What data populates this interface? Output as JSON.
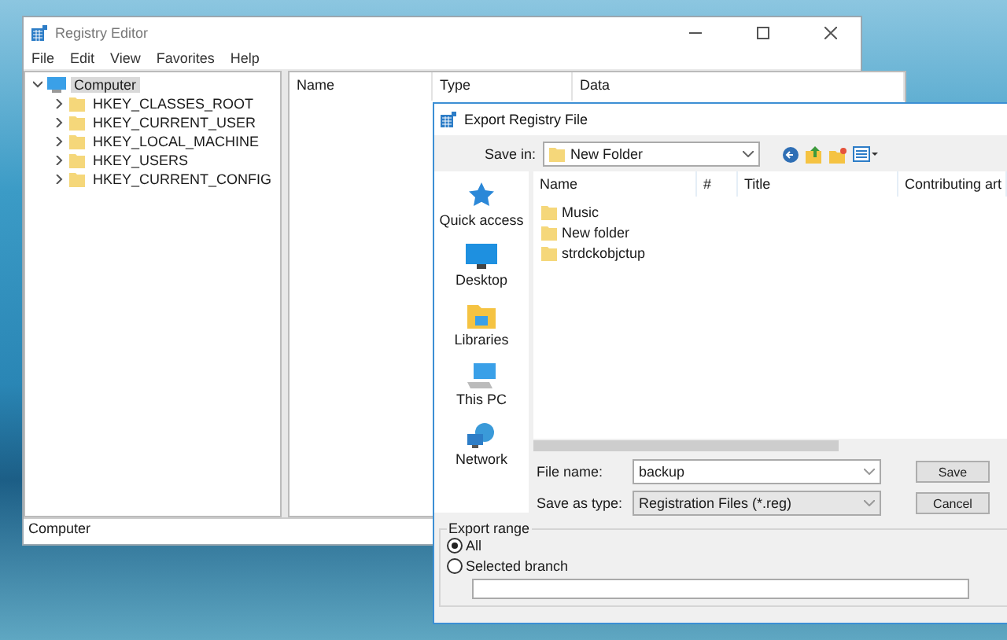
{
  "registry_window": {
    "title": "Registry Editor",
    "menu": [
      "File",
      "Edit",
      "View",
      "Favorites",
      "Help"
    ],
    "tree": {
      "label": "Computer",
      "expanded": true,
      "selected": true,
      "children": [
        {
          "label": "HKEY_CLASSES_ROOT",
          "expanded": false
        },
        {
          "label": "HKEY_CURRENT_USER",
          "expanded": false
        },
        {
          "label": "HKEY_LOCAL_MACHINE",
          "expanded": false
        },
        {
          "label": "HKEY_USERS",
          "expanded": false
        },
        {
          "label": "HKEY_CURRENT_CONFIG",
          "expanded": false
        }
      ]
    },
    "columns": [
      "Name",
      "Type",
      "Data"
    ],
    "status_bar": "Computer"
  },
  "export_dialog": {
    "title": "Export Registry File",
    "save_in_label": "Save in:",
    "save_in_value": "New Folder",
    "places": [
      {
        "label": "Quick access",
        "kind": "star"
      },
      {
        "label": "Desktop",
        "kind": "desktop"
      },
      {
        "label": "Libraries",
        "kind": "libraries"
      },
      {
        "label": "This PC",
        "kind": "pc"
      },
      {
        "label": "Network",
        "kind": "network"
      }
    ],
    "columns": [
      "Name",
      "#",
      "Title",
      "Contributing art"
    ],
    "files": [
      "Music",
      "New folder",
      "strdckobjctup"
    ],
    "file_name_label": "File name:",
    "file_name": "backup",
    "save_as_type_label": "Save as type:",
    "save_as_type": "Registration Files (*.reg)",
    "buttons": [
      "Save",
      "Cancel"
    ],
    "export_range": {
      "title": "Export range",
      "options": [
        {
          "label": "All",
          "selected": true
        },
        {
          "label": "Selected branch",
          "selected": false
        }
      ]
    }
  }
}
